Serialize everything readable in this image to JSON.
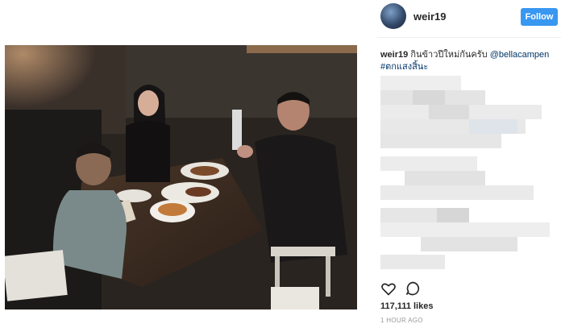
{
  "post": {
    "username": "weir19",
    "follow_label": "Follow",
    "caption": {
      "username": "weir19",
      "text": "กินข้าวปีใหม่กันครับ",
      "mention": "@bellacampen",
      "hashtag": "#ตกแสงสิ้นะ"
    },
    "likes": "117,111 likes",
    "time": "1 HOUR AGO"
  },
  "icons": {
    "like": "heart-icon",
    "comment": "comment-icon"
  },
  "colors": {
    "follow_button": "#3897f0",
    "link": "#003569",
    "muted": "#999999"
  }
}
